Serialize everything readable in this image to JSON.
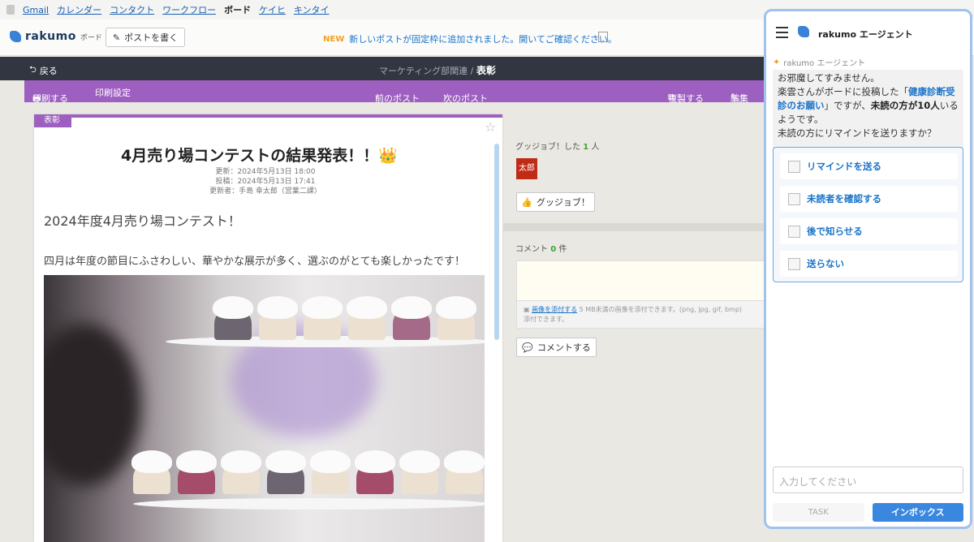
{
  "topbar": {
    "links": [
      "Gmail",
      "カレンダー",
      "コンタクト",
      "ワークフロー",
      "ボード",
      "ケイヒ",
      "キンタイ"
    ]
  },
  "header": {
    "logo_text": "rakumo",
    "logo_sub": "ボード",
    "write_post": "ポストを書く",
    "notice_badge": "NEW",
    "notice_text": "新しいポストが固定枠に追加されました。開いてご確認ください。"
  },
  "darkbar": {
    "back": "戻る",
    "crumb_parent": "マーケティング部関連 /",
    "crumb_current": "表彰"
  },
  "toolbar": {
    "print": "印刷する",
    "print_settings": "印刷設定",
    "prev": "前のポスト",
    "next": "次のポスト",
    "duplicate": "複製する",
    "edit": "編集"
  },
  "post": {
    "tag": "表彰",
    "title": "4月売り場コンテストの結果発表！！",
    "title_emoji": "👑",
    "updated": "更新：2024年5月13日 18:00",
    "posted": "投稿：2024年5月13日 17:41",
    "updater": "更新者：手島 幸太郎（営業二課）",
    "heading": "2024年度4月売り場コンテスト！",
    "lead": "四月は年度の節目にふさわしい、華やかな展示が多く、選ぶのがとても楽しかったです！"
  },
  "goodjob": {
    "label": "グッジョブ！した",
    "count": "1",
    "unit": "人",
    "avatar": "太郎",
    "button": "グッジョブ！"
  },
  "comment": {
    "label": "コメント",
    "count": "0",
    "unit": "件",
    "attach_link": "画像を添付する",
    "attach_note": "5 MB未満の画像を添付できます。(png, jpg, gif, bmp)",
    "attach_note2": "添付できます。",
    "button": "コメントする"
  },
  "agent": {
    "title": "rakumo エージェント",
    "sender": "rakumo エージェント",
    "msg_line1": "お邪魔してすみません。",
    "msg_pre": "楽雲さんがボードに投稿した「",
    "msg_link": "健康診断受診のお願い",
    "msg_mid": "」ですが、",
    "msg_bold": "未読の方が10人",
    "msg_post": "いるようです。",
    "msg_question": "未読の方にリマインドを送りますか？",
    "options": [
      "リマインドを送る",
      "未読者を確認する",
      "後で知らせる",
      "送らない"
    ],
    "input_placeholder": "入力してください",
    "tab_task": "TASK",
    "tab_inbox": "インボックス"
  }
}
